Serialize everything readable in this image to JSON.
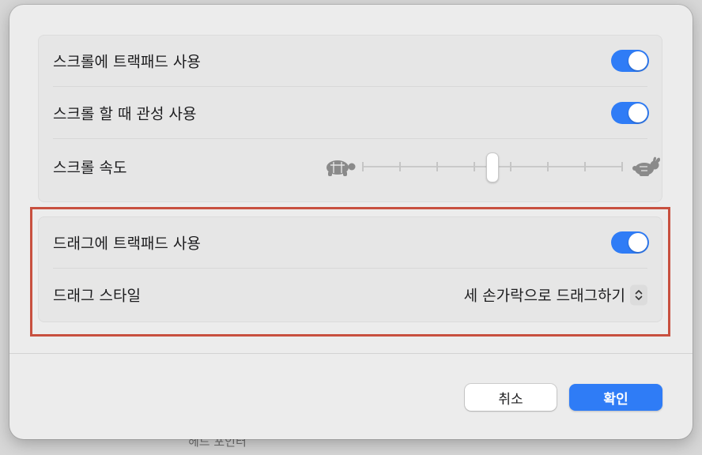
{
  "background": {
    "partial_text": "헤드 포인터"
  },
  "scroll_group": {
    "scroll_with_trackpad": {
      "label": "스크롤에 트랙패드 사용",
      "on": true
    },
    "scroll_inertia": {
      "label": "스크롤 할 때 관성 사용",
      "on": true
    },
    "scroll_speed": {
      "label": "스크롤 속도",
      "slow_icon": "turtle-icon",
      "fast_icon": "rabbit-icon",
      "tick_count": 8,
      "level": 0.5
    }
  },
  "drag_group": {
    "drag_with_trackpad": {
      "label": "드래그에 트랙패드 사용",
      "on": true
    },
    "drag_style": {
      "label": "드래그 스타일",
      "value": "세 손가락으로 드래그하기",
      "control_icon": "up-down-chevron-icon"
    }
  },
  "buttons": {
    "cancel": "취소",
    "ok": "확인"
  },
  "colors": {
    "accent": "#2f7cf6",
    "highlight_border": "#c8503f"
  }
}
